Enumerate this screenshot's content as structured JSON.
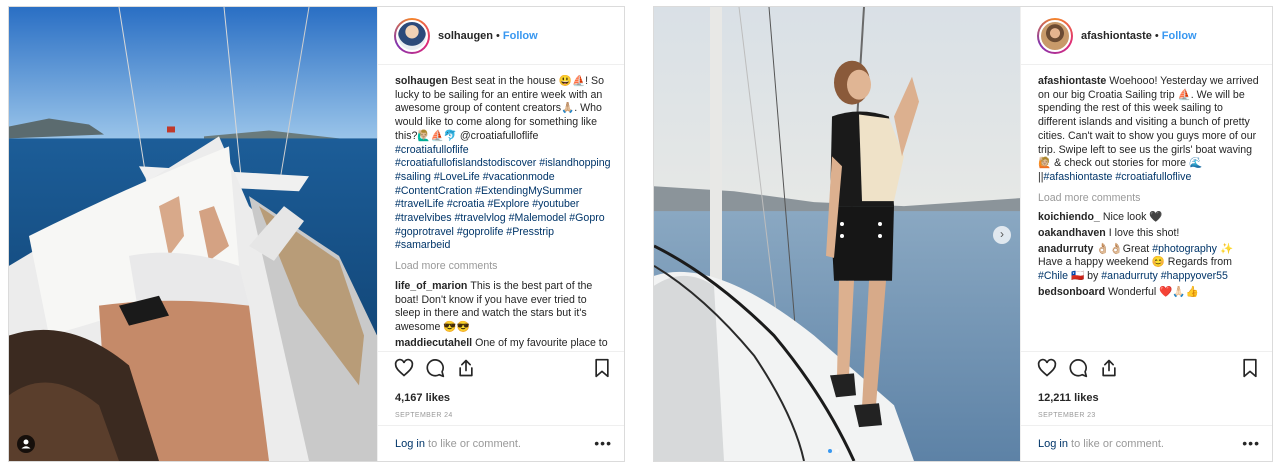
{
  "post1": {
    "username": "solhaugen",
    "follow_label": "Follow",
    "dot": "•",
    "caption_user": "solhaugen",
    "caption_text": "Best seat in the house 😃⛵! So lucky to be sailing for an entire week with an awesome group of content creators🙏🏼. Who would like to come along for something like this?🙋🏼‍♂️⛵🐬 @croatiafulloflife",
    "caption_tags": "#croatiafulloflife #croatiafullofislandstodiscover #islandhopping #sailing #LoveLife #vacationmode #ContentCration #ExtendingMySummer #travelLife #croatia #Explore #youtuber #travelvibes #travelvlog #Malemodel #Gopro #goprotravel #goprolife #Presstrip #samarbeid",
    "load_more": "Load more comments",
    "comments": [
      {
        "user": "life_of_marion",
        "text": "This is the best part of the boat! Don't know if you have ever tried to sleep in there and watch the stars but it's awesome 😎😎"
      },
      {
        "user": "maddiecutahell",
        "text": "One of my favourite place to"
      }
    ],
    "likes": "4,167 likes",
    "date": "SEPTEMBER 24",
    "login_link": "Log in",
    "login_rest": " to like or comment.",
    "more": "•••"
  },
  "post2": {
    "username": "afashiontaste",
    "follow_label": "Follow",
    "dot": "•",
    "caption_user": "afashiontaste",
    "caption_text": "Woehooo! Yesterday we arrived on our big Croatia Sailing trip ⛵. We will be spending the rest of this week sailing to different islands and visiting a bunch of pretty cities. Can't wait to show you guys more of our trip. Swipe left to see us the girls' boat waving 🙋🏼 & check out stories for more 🌊 ||",
    "caption_tags": "#afashiontaste #croatiafulloflive",
    "load_more": "Load more comments",
    "comments": [
      {
        "user": "koichiendo_",
        "text": "Nice look 🖤"
      },
      {
        "user": "oakandhaven",
        "text": "I love this shot!"
      },
      {
        "user": "anadurruty",
        "text": "👌🏼👌🏼Great",
        "tag": "#photography",
        "text2": "✨ Have a happy weekend 😊 Regards from",
        "tag2": "#Chile",
        "text3": "🇨🇱 by",
        "tag3": "#anadurruty #happyover55"
      },
      {
        "user": "bedsonboard",
        "text": "Wonderful ❤️🙏🏻👍"
      }
    ],
    "likes": "12,211 likes",
    "date": "SEPTEMBER 23",
    "login_link": "Log in",
    "login_rest": " to like or comment.",
    "more": "•••",
    "next_arrow": "›"
  },
  "colors": {
    "link_blue": "#3897f0",
    "tag_blue": "#003569",
    "muted": "#999999",
    "text": "#262626",
    "border": "#dbdbdb"
  },
  "icons": [
    "heart-icon",
    "comment-icon",
    "share-icon",
    "bookmark-icon",
    "more-options-icon",
    "next-arrow-icon",
    "user-tag-icon"
  ]
}
